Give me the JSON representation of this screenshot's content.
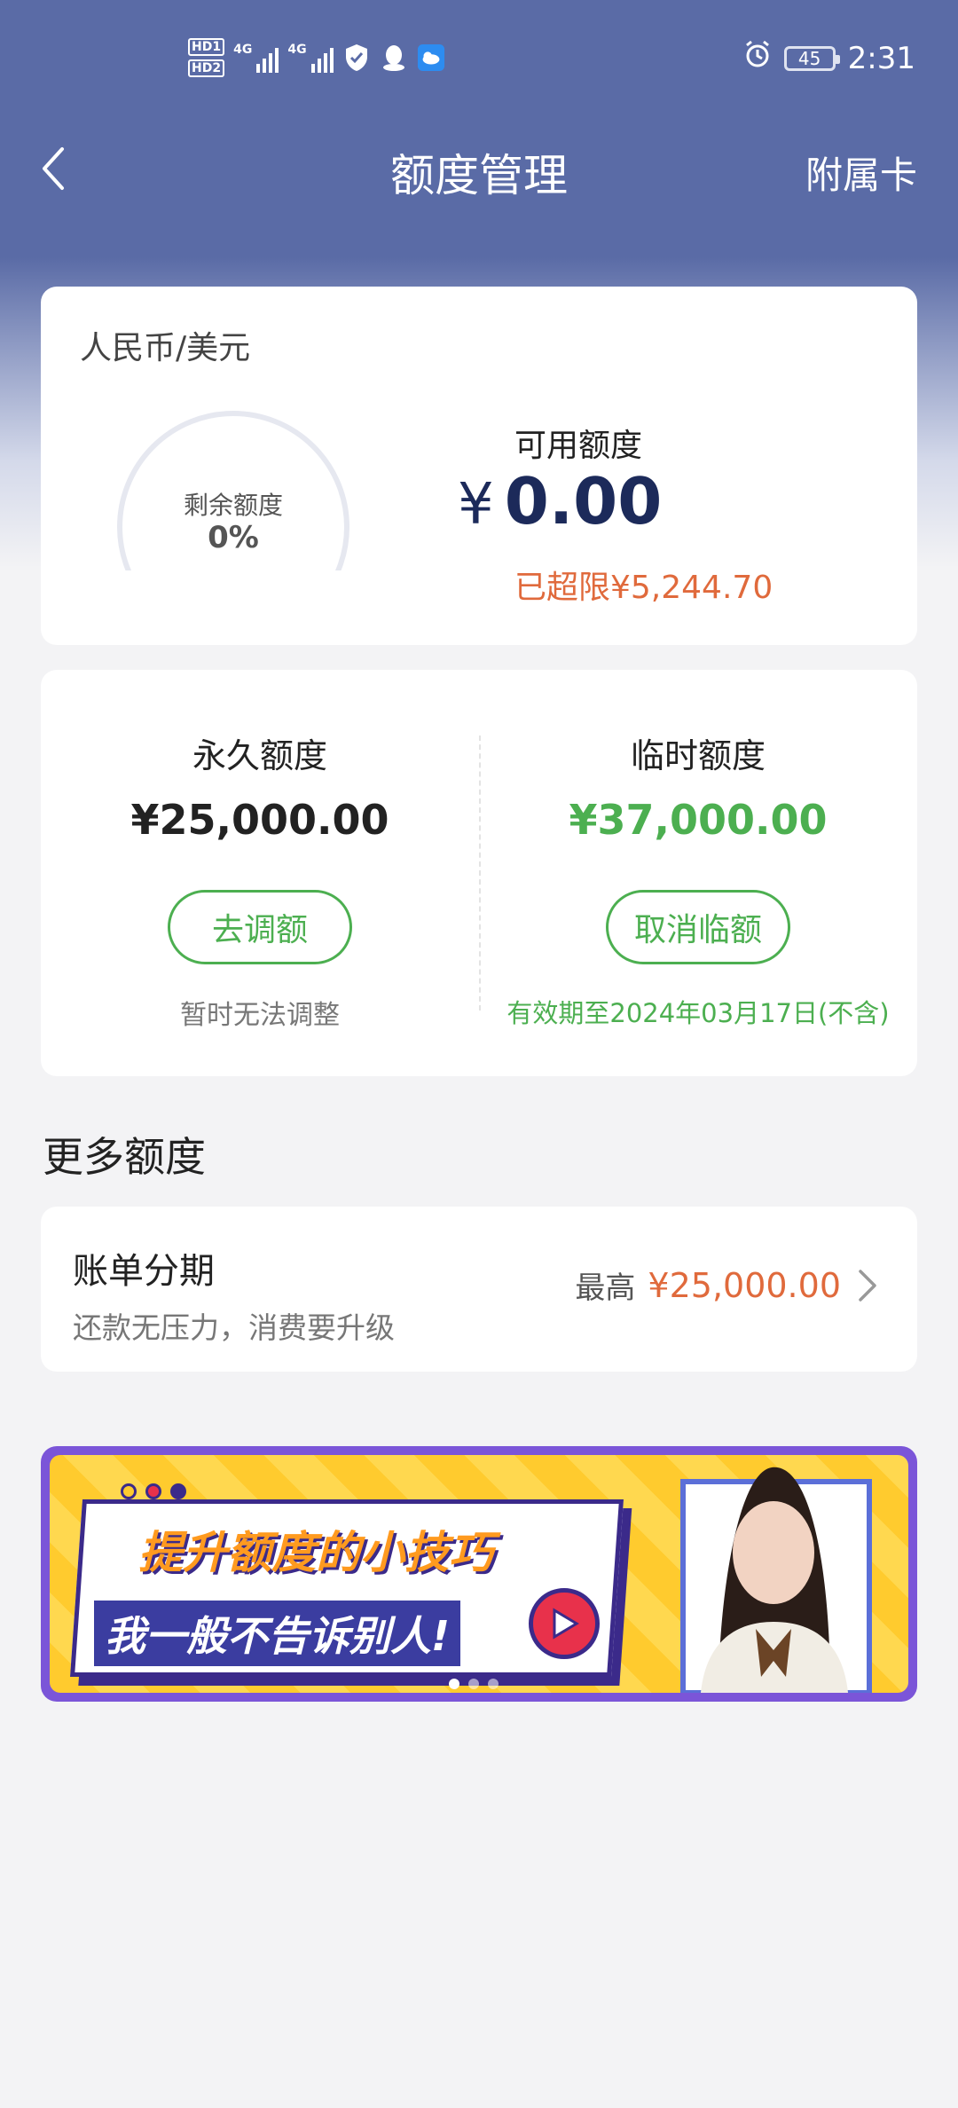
{
  "status_bar": {
    "hd1": "HD1",
    "hd2": "HD2",
    "net1": "4G",
    "net2": "4G",
    "battery": "45",
    "time": "2:31"
  },
  "header": {
    "title": "额度管理",
    "right_action": "附属卡"
  },
  "summary": {
    "currency": "人民币/美元",
    "remaining_label": "剩余额度",
    "remaining_percent": "0%",
    "available_label": "可用额度",
    "currency_symbol": "¥",
    "available_amount": "0.00",
    "overlimit_text": "已超限¥5,244.70"
  },
  "limits": {
    "permanent": {
      "title": "永久额度",
      "amount": "¥25,000.00",
      "button": "去调额",
      "note": "暂时无法调整"
    },
    "temporary": {
      "title": "临时额度",
      "amount": "¥37,000.00",
      "button": "取消临额",
      "note": "有效期至2024年03月17日(不含)"
    }
  },
  "more": {
    "section_title": "更多额度",
    "installment": {
      "title": "账单分期",
      "subtitle": "还款无压力，消费要升级",
      "max_label": "最高",
      "amount": "¥25,000.00"
    }
  },
  "banner": {
    "line1": "提升额度的小技巧",
    "line2": "我一般不告诉别人!",
    "page_count": 3,
    "active_page": 1
  },
  "colors": {
    "header_bg": "#5a6ba6",
    "accent_green": "#4caf50",
    "accent_orange": "#e06a3c",
    "amount_navy": "#1c2a5a"
  }
}
